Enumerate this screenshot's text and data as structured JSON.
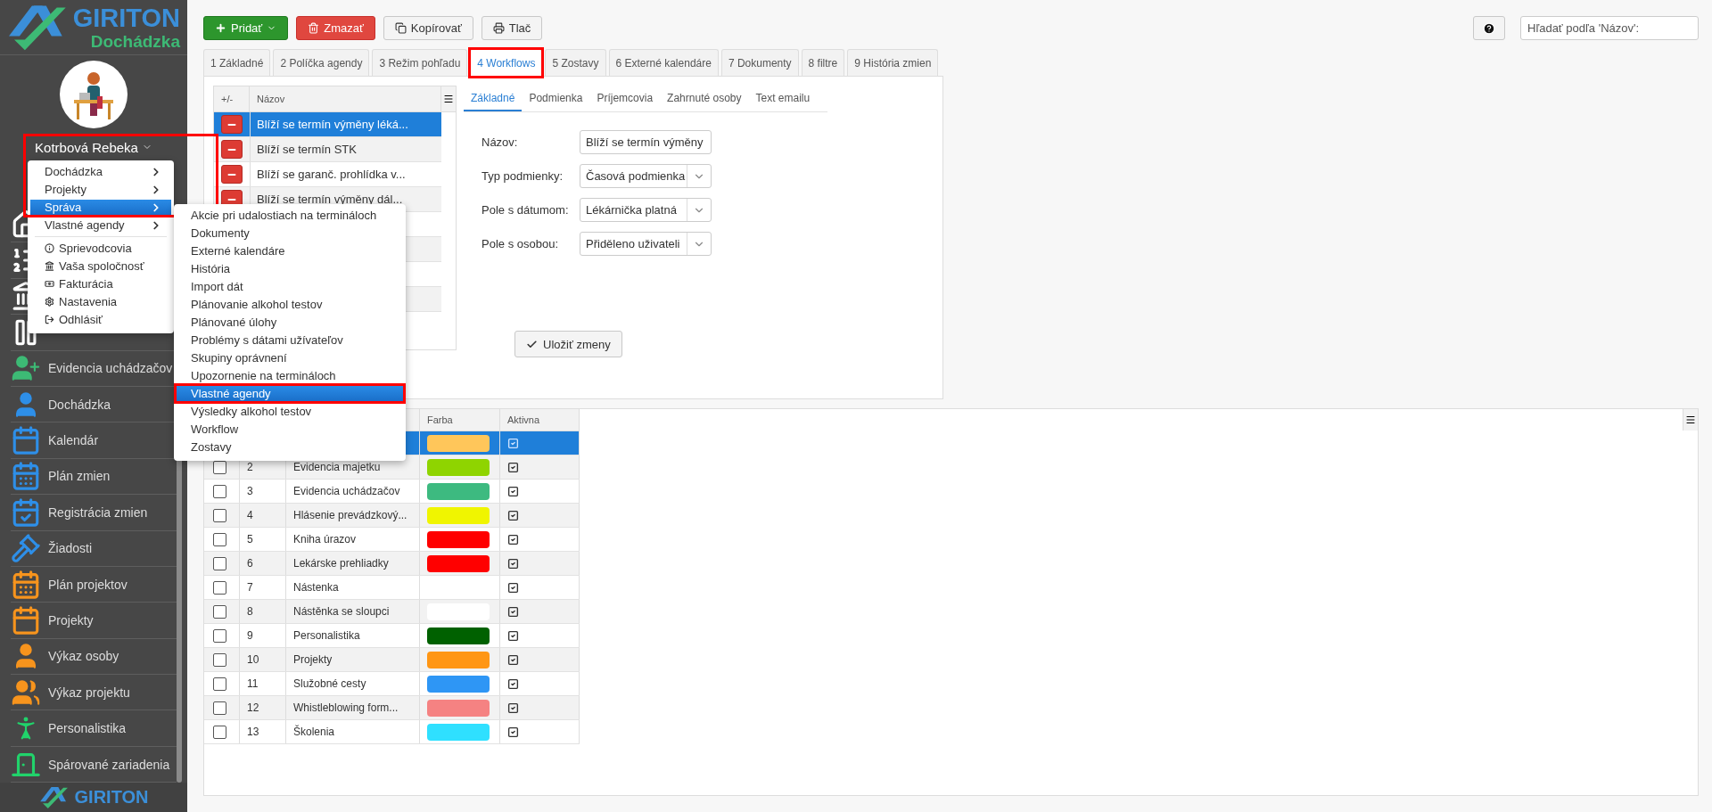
{
  "app": {
    "logo_title": "GIRITON",
    "logo_subtitle": "Dochádzka",
    "footer_logo": "GIRITON"
  },
  "user": {
    "name": "Kotrbová Rebeka"
  },
  "user_menu": {
    "items": [
      {
        "label": "Dochádzka",
        "kind": "submenu",
        "selected": false
      },
      {
        "label": "Projekty",
        "kind": "submenu",
        "selected": false
      },
      {
        "label": "Správa",
        "kind": "submenu",
        "selected": true
      },
      {
        "label": "Vlastné agendy",
        "kind": "submenu",
        "selected": false
      },
      {
        "label": "Sprievodcovia",
        "kind": "action",
        "selected": false
      },
      {
        "label": "Vaša spoločnosť",
        "kind": "action",
        "selected": false
      },
      {
        "label": "Fakturácia",
        "kind": "action",
        "selected": false
      },
      {
        "label": "Nastavenia",
        "kind": "action",
        "selected": false
      },
      {
        "label": "Odhlásiť",
        "kind": "action",
        "selected": false
      }
    ]
  },
  "submenu": {
    "items": [
      {
        "label": "Akcie pri udalostiach na termináloch",
        "selected": false
      },
      {
        "label": "Dokumenty",
        "selected": false
      },
      {
        "label": "Externé kalendáre",
        "selected": false
      },
      {
        "label": "História",
        "selected": false
      },
      {
        "label": "Import dát",
        "selected": false
      },
      {
        "label": "Plánovanie alkohol testov",
        "selected": false
      },
      {
        "label": "Plánované úlohy",
        "selected": false
      },
      {
        "label": "Problémy s dátami užívateľov",
        "selected": false
      },
      {
        "label": "Skupiny oprávnení",
        "selected": false
      },
      {
        "label": "Upozornenie na termináloch",
        "selected": false
      },
      {
        "label": "Vlastné agendy",
        "selected": true
      },
      {
        "label": "Výsledky alkohol testov",
        "selected": false
      },
      {
        "label": "Workflow",
        "selected": false
      },
      {
        "label": "Zostavy",
        "selected": false
      }
    ]
  },
  "sidebar": {
    "items": [
      {
        "color": "#ffffff"
      },
      {
        "color": "#ffffff"
      },
      {
        "color": "#ffffff"
      },
      {
        "color": "#ffffff"
      },
      {
        "label": "Evidencia uchádzačov",
        "color": "#3dba75"
      },
      {
        "label": "Dochádzka",
        "color": "#2e8fe8"
      },
      {
        "label": "Kalendár",
        "color": "#2e8fe8"
      },
      {
        "label": "Plán zmien",
        "color": "#2e8fe8"
      },
      {
        "label": "Registrácia zmien",
        "color": "#2e8fe8"
      },
      {
        "label": "Žiadosti",
        "color": "#2e8fe8"
      },
      {
        "label": "Plán projektov",
        "color": "#f7941d"
      },
      {
        "label": "Projekty",
        "color": "#f7941d"
      },
      {
        "label": "Výkaz osoby",
        "color": "#f7941d"
      },
      {
        "label": "Výkaz projektu",
        "color": "#f7941d"
      },
      {
        "label": "Personalistika",
        "color": "#21d36b"
      },
      {
        "label": "Spárované zariadenia",
        "color": "#21d36b"
      }
    ]
  },
  "toolbar": {
    "buttons": [
      {
        "label": "Pridať",
        "kind": "add"
      },
      {
        "label": "Zmazať",
        "kind": "delete"
      },
      {
        "label": "Kopírovať",
        "kind": "copy"
      },
      {
        "label": "Tlač",
        "kind": "print"
      }
    ]
  },
  "search": {
    "placeholder": "Hľadať podľa 'Názov':"
  },
  "tabs": [
    {
      "label": "1 Základné",
      "selected": false
    },
    {
      "label": "2 Políčka agendy",
      "selected": false
    },
    {
      "label": "3 Režim pohľadu",
      "selected": false
    },
    {
      "label": "4 Workflows",
      "selected": true
    },
    {
      "label": "5 Zostavy",
      "selected": false
    },
    {
      "label": "6 Externé kalendáre",
      "selected": false
    },
    {
      "label": "7 Dokumenty",
      "selected": false
    },
    {
      "label": "8 filtre",
      "selected": false
    },
    {
      "label": "9 História zmien",
      "selected": false
    }
  ],
  "workflows": {
    "columns": [
      "+/-",
      "Názov"
    ],
    "rows": [
      {
        "name": "Blíží se termín výměny léká...",
        "selected": true
      },
      {
        "name": "Blíží se termín STK",
        "selected": false
      },
      {
        "name": "Blíží se garanč. prohlídka v...",
        "selected": false
      },
      {
        "name": "Blíží se termín výměny dál...",
        "selected": false
      }
    ]
  },
  "subtabs": [
    {
      "label": "Základné",
      "selected": true
    },
    {
      "label": "Podmienka",
      "selected": false
    },
    {
      "label": "Príjemcovia",
      "selected": false
    },
    {
      "label": "Zahrnuté osoby",
      "selected": false
    },
    {
      "label": "Text emailu",
      "selected": false
    }
  ],
  "form": {
    "fields": [
      {
        "label": "Názov:",
        "kind": "text",
        "value": "Blíží se termín výměny"
      },
      {
        "label": "Typ podmienky:",
        "kind": "select",
        "value": "Časová podmienka"
      },
      {
        "label": "Pole s dátumom:",
        "kind": "select",
        "value": "Lékárnička platná"
      },
      {
        "label": "Pole s osobou:",
        "kind": "select",
        "value": "Přiděleno uživateli"
      }
    ]
  },
  "save_button": "Uložiť zmeny",
  "table": {
    "columns": [
      "Farba",
      "Aktivna"
    ],
    "rows": [
      {
        "color": "#ffc65a",
        "active": true,
        "selected": true
      },
      {
        "checked": false,
        "number": "2",
        "name": "Evidencia majetku",
        "color": "#8fd400",
        "active": true,
        "selected": false
      },
      {
        "checked": false,
        "number": "3",
        "name": "Evidencia uchádzačov",
        "color": "#3dba80",
        "active": true,
        "selected": false
      },
      {
        "checked": false,
        "number": "4",
        "name": "Hlásenie prevádzkový...",
        "color": "#f0f500",
        "active": true,
        "selected": false
      },
      {
        "checked": false,
        "number": "5",
        "name": "Kniha úrazov",
        "color": "#ff0000",
        "active": true,
        "selected": false
      },
      {
        "checked": false,
        "number": "6",
        "name": "Lekárske prehliadky",
        "color": "#ff0000",
        "active": true,
        "selected": false
      },
      {
        "checked": false,
        "number": "7",
        "name": "Nástenka",
        "active": true,
        "selected": false
      },
      {
        "checked": false,
        "number": "8",
        "name": "Nástěnka se sloupci",
        "color": "#ffffff",
        "active": true,
        "selected": false
      },
      {
        "checked": false,
        "number": "9",
        "name": "Personalistika",
        "color": "#006100",
        "active": true,
        "selected": false
      },
      {
        "checked": false,
        "number": "10",
        "name": "Projekty",
        "color": "#ff9614",
        "active": true,
        "selected": false
      },
      {
        "checked": false,
        "number": "11",
        "name": "Služobné cesty",
        "color": "#2e96f5",
        "active": true,
        "selected": false
      },
      {
        "checked": false,
        "number": "12",
        "name": "Whistleblowing form...",
        "color": "#f58282",
        "active": true,
        "selected": false
      },
      {
        "checked": false,
        "number": "13",
        "name": "Školenia",
        "color": "#2fe0ff",
        "active": true,
        "selected": false
      }
    ]
  }
}
